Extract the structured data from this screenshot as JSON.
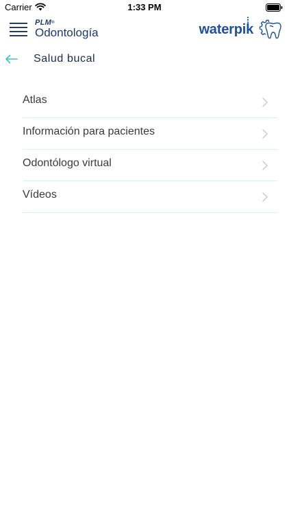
{
  "status_bar": {
    "carrier": "Carrier",
    "time": "1:33 PM"
  },
  "header": {
    "brand_top": "PLM",
    "brand_registered": "®",
    "brand_name": "Odontología",
    "partner_logo": "waterpik",
    "menu_icon": "hamburger-menu-icon",
    "partner_icon": "tooth-gear-icon"
  },
  "section": {
    "title": "Salud bucal",
    "back_icon": "back-arrow-icon"
  },
  "menu": {
    "items": [
      {
        "label": "Atlas"
      },
      {
        "label": "Información para pacientes"
      },
      {
        "label": "Odontólogo virtual"
      },
      {
        "label": "Vídeos"
      }
    ]
  },
  "colors": {
    "brand_navy": "#1b3a6b",
    "waterpik_blue": "#1c4f9c",
    "accent_teal": "#3bc4c9",
    "divider": "#d8f0ef",
    "chevron": "#c8c8c8"
  }
}
